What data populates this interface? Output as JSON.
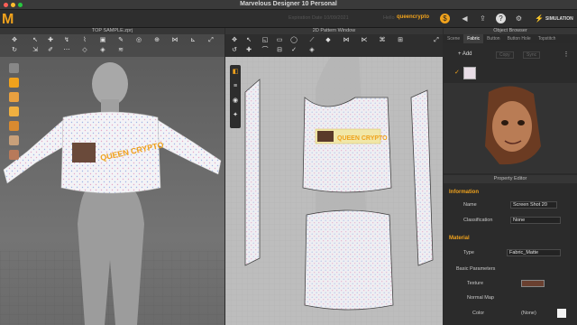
{
  "app": {
    "title": "Marvelous Designer 10 Personal"
  },
  "toolbar": {
    "expire": "Expiration Date 10/09/2021",
    "user_label": "Hello",
    "username": "queencrypto",
    "simulation": "SIMULATION"
  },
  "window3d": {
    "title": "TOP SAMPLE.zprj"
  },
  "window2d": {
    "title": "2D Pattern Window"
  },
  "object_browser": {
    "title": "Object Browser",
    "tabs": [
      "Scene",
      "Fabric",
      "Button",
      "Button Hole",
      "Topstitch"
    ],
    "active_tab": "Fabric",
    "add": "+ Add",
    "copy": "Copy",
    "sync": "Sync"
  },
  "texture_label_text": "QUEEN CRYPTO",
  "property_editor": {
    "title": "Property Editor",
    "information": {
      "heading": "Information",
      "name_label": "Name",
      "name_value": "Screen Shot 20",
      "classification_label": "Classification",
      "classification_value": "None"
    },
    "material": {
      "heading": "Material",
      "type_label": "Type",
      "type_value": "Fabric_Matte",
      "basic_heading": "Basic Parameters",
      "texture_label": "Texture",
      "normal_label": "Normal Map",
      "color_label": "Color",
      "color_value": "(None)"
    }
  },
  "colors": {
    "accent": "#f0a21c",
    "panel": "#2b2b2b"
  }
}
